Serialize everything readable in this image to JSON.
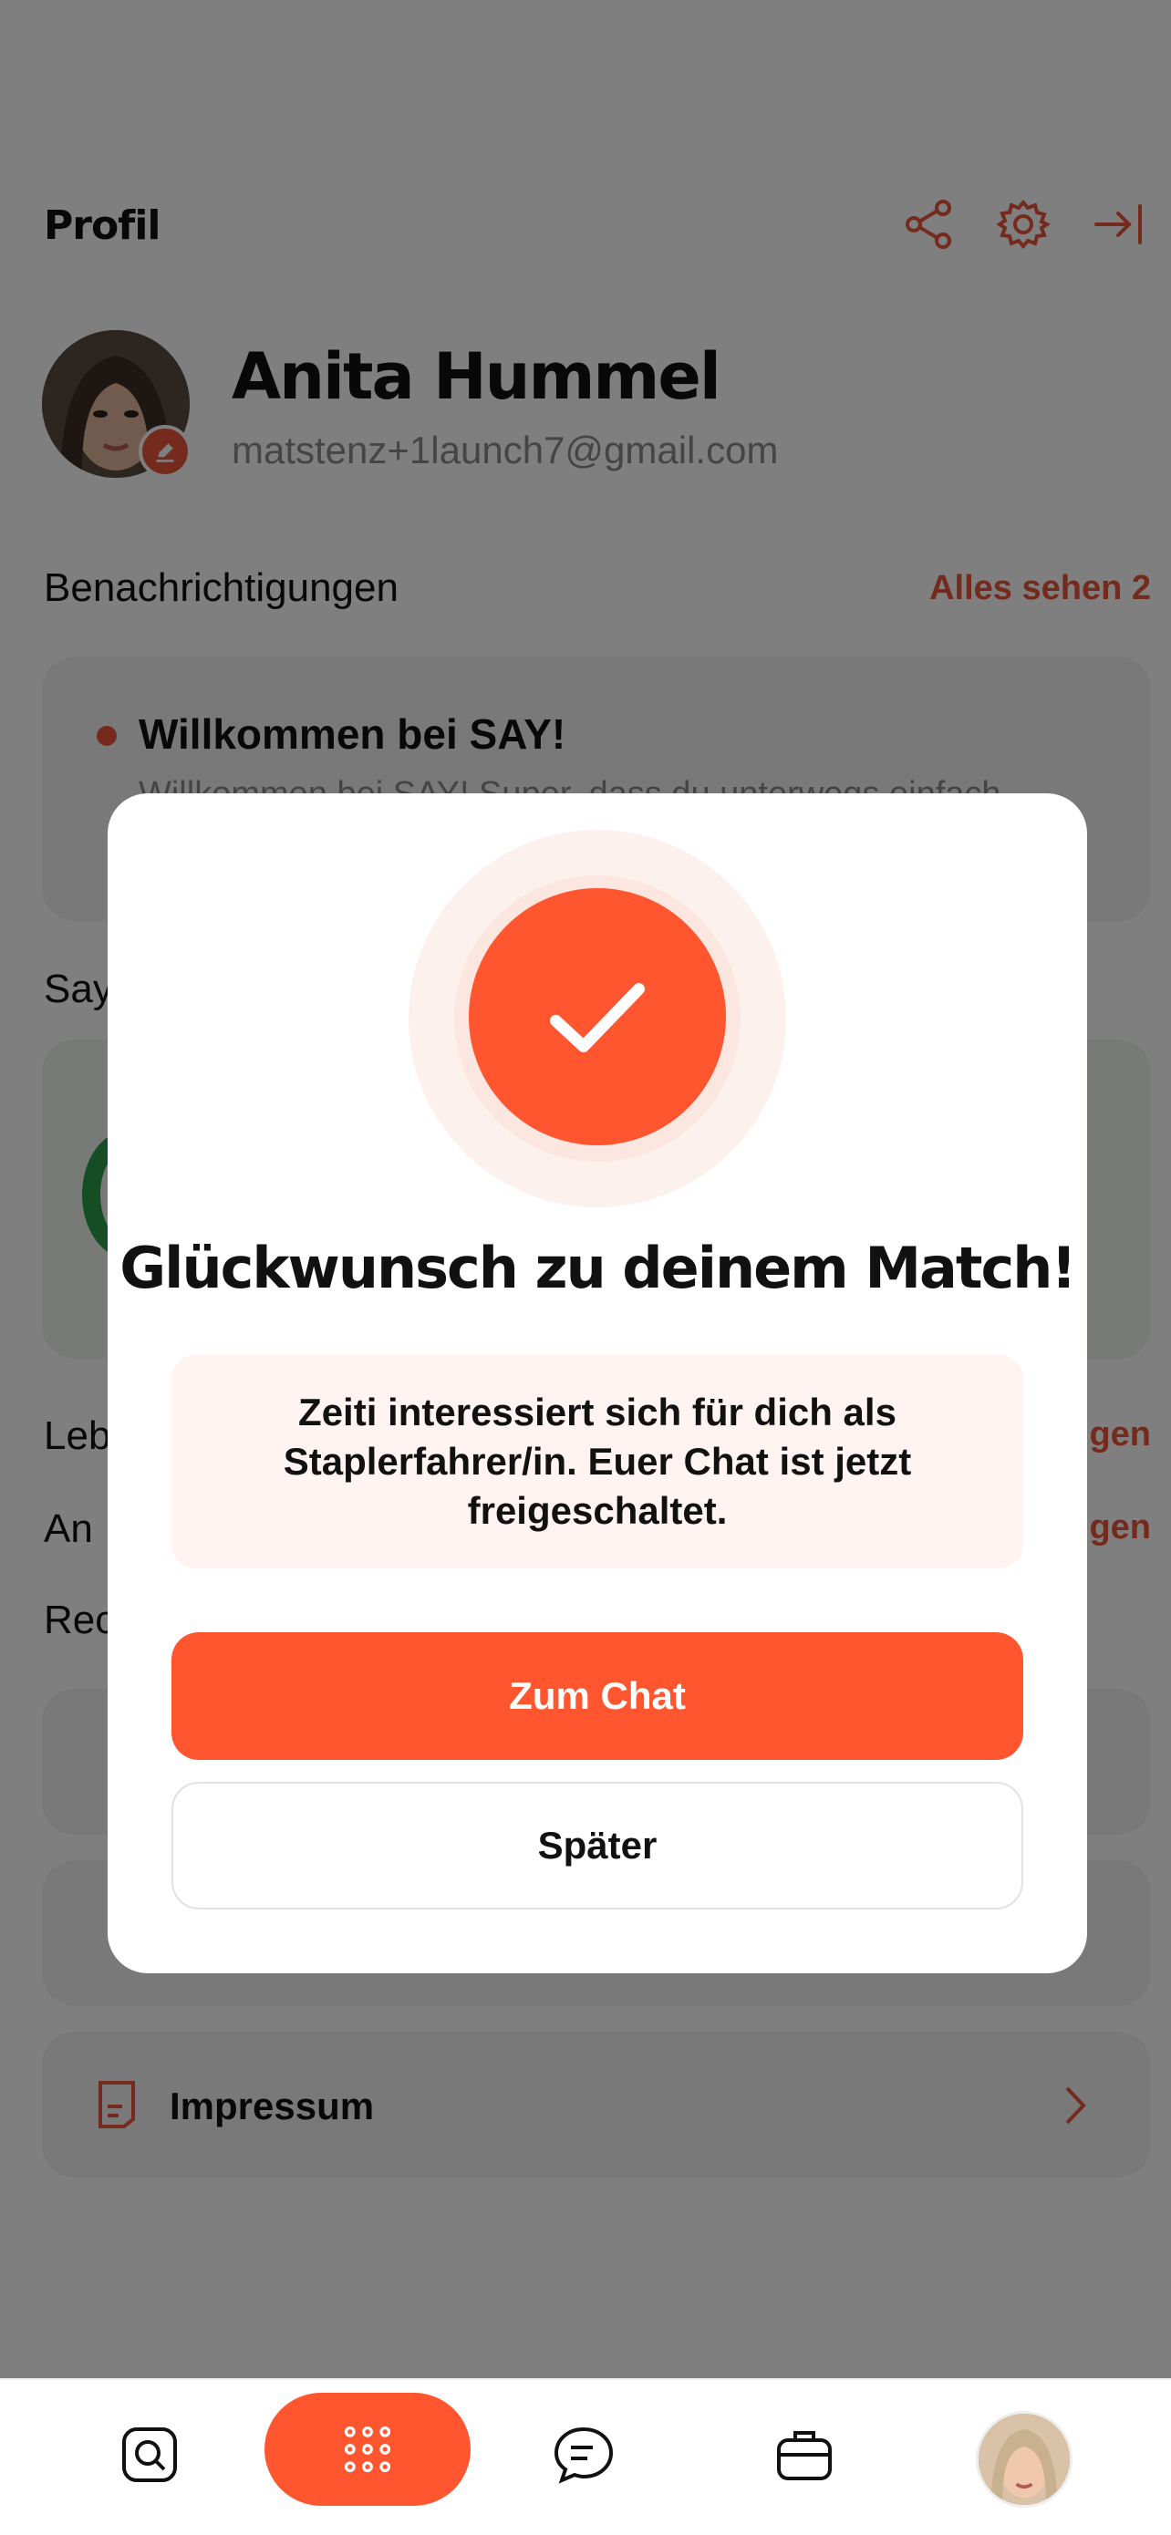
{
  "header": {
    "title": "Profil",
    "icons": [
      "share-icon",
      "gear-icon",
      "logout-icon"
    ]
  },
  "profile": {
    "name": "Anita Hummel",
    "email": "matstenz+1launch7@gmail.com"
  },
  "notifications": {
    "title": "Benachrichtigungen",
    "see_all": "Alles sehen 2",
    "item_title": "Willkommen bei SAY!",
    "item_preview": "Willkommen bei SAY! Super, dass du unterwegs einfach"
  },
  "sections": {
    "say_partial": "Say",
    "leb_partial": "Leb",
    "leb_link_partial": "gen",
    "an_partial": "An",
    "an_link_partial": "gen",
    "rec_partial": "Rec"
  },
  "menu": {
    "impressum": "Impressum"
  },
  "modal": {
    "title": "Glückwunsch zu deinem Match!",
    "message": "Zeiti interessiert sich für dich als Staplerfahrer/in. Euer Chat ist jetzt freigeschaltet.",
    "primary_label": "Zum Chat",
    "secondary_label": "Später"
  },
  "tabbar": {
    "icons": [
      "search-icon",
      "apps-grid-icon",
      "chat-icon",
      "briefcase-icon",
      "profile-avatar"
    ]
  },
  "colors": {
    "accent": "#ff5630",
    "accent_text": "#e8563a",
    "overlay": "rgba(0,0,0,0.5)"
  }
}
